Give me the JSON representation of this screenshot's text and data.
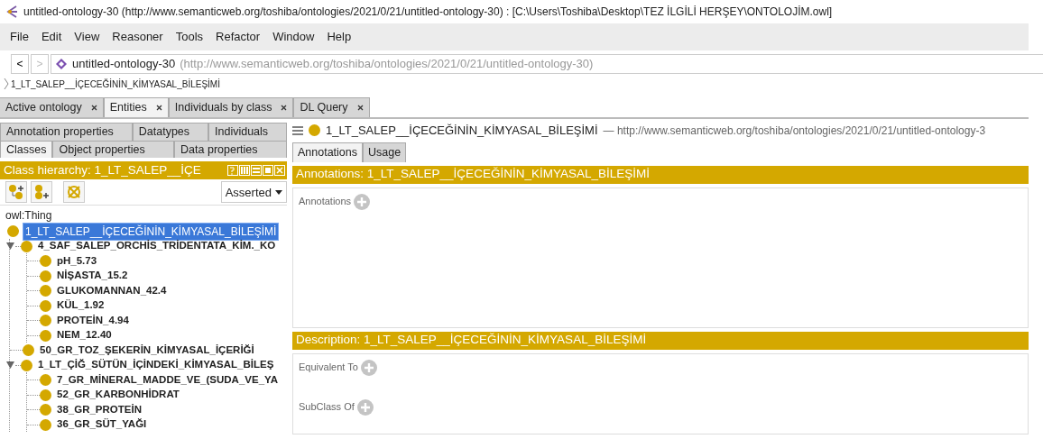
{
  "window": {
    "title": "untitled-ontology-30 (http://www.semanticweb.org/toshiba/ontologies/2021/0/21/untitled-ontology-30)  : [C:\\Users\\Toshiba\\Desktop\\TEZ İLGİLİ HERŞEY\\ONTOLOJİM.owl]"
  },
  "menu": [
    "File",
    "Edit",
    "View",
    "Reasoner",
    "Tools",
    "Refactor",
    "Window",
    "Help"
  ],
  "address": {
    "back": "<",
    "forward": ">",
    "name": "untitled-ontology-30",
    "iri": "(http://www.semanticweb.org/toshiba/ontologies/2021/0/21/untitled-ontology-30)"
  },
  "breadcrumb": "1_LT_SALEP__İÇECEĞİNİN_KİMYASAL_BİLEŞİMİ",
  "workspace_tabs": [
    {
      "label": "Active ontology",
      "selected": false
    },
    {
      "label": "Entities",
      "selected": true
    },
    {
      "label": "Individuals by class",
      "selected": false
    },
    {
      "label": "DL Query",
      "selected": false
    }
  ],
  "left": {
    "tab_rows": [
      [
        {
          "label": "Annotation properties",
          "selected": false
        },
        {
          "label": "Datatypes",
          "selected": false
        },
        {
          "label": "Individuals",
          "selected": false
        }
      ],
      [
        {
          "label": "Classes",
          "selected": true
        },
        {
          "label": "Object properties",
          "selected": false
        },
        {
          "label": "Data properties",
          "selected": false
        }
      ]
    ],
    "header": "Class hierarchy: 1_LT_SALEP__İÇE",
    "mode": "Asserted",
    "root": "owl:Thing",
    "tree": [
      {
        "label": "1_LT_SALEP__İÇECEĞİNİN_KİMYASAL_BİLEŞİMİ",
        "selected": true,
        "children": [
          {
            "label": "4_SAF_SALEP_ORCHİS_TRİDENTATA_KİM._KO",
            "selected": false,
            "expanded": true,
            "children": [
              {
                "label": "pH_5.73",
                "selected": false
              },
              {
                "label": "NİŞASTA_15.2",
                "selected": false
              },
              {
                "label": "GLUKOMANNAN_42.4",
                "selected": false
              },
              {
                "label": "KÜL_1.92",
                "selected": false
              },
              {
                "label": "PROTEİN_4.94",
                "selected": false
              },
              {
                "label": "NEM_12.40",
                "selected": false
              }
            ]
          },
          {
            "label": "50_GR_TOZ_ŞEKERİN_KİMYASAL_İÇERİĞİ",
            "selected": false
          },
          {
            "label": "1_LT_ÇİĞ_SÜTÜN_İÇİNDEKİ_KİMYASAL_BİLEŞ",
            "selected": false,
            "expanded": true,
            "children": [
              {
                "label": "7_GR_MİNERAL_MADDE_VE_(SUDA_VE_YA",
                "selected": false
              },
              {
                "label": "52_GR_KARBONHİDRAT",
                "selected": false
              },
              {
                "label": "38_GR_PROTEİN",
                "selected": false
              },
              {
                "label": "36_GR_SÜT_YAĞI",
                "selected": false
              }
            ]
          }
        ]
      }
    ]
  },
  "right": {
    "title": "1_LT_SALEP__İÇECEĞİNİN_KİMYASAL_BİLEŞİMİ",
    "iri": "— http://www.semanticweb.org/toshiba/ontologies/2021/0/21/untitled-ontology-3",
    "tabs": [
      {
        "label": "Annotations",
        "selected": true
      },
      {
        "label": "Usage",
        "selected": false
      }
    ],
    "annotations_header": "Annotations: 1_LT_SALEP__İÇECEĞİNİN_KİMYASAL_BİLEŞİMİ",
    "annotation_sections": [
      "Annotations"
    ],
    "description_header": "Description: 1_LT_SALEP__İÇECEĞİNİN_KİMYASAL_BİLEŞİMİ",
    "description_sections": [
      "Equivalent To",
      "SubClass Of"
    ]
  }
}
